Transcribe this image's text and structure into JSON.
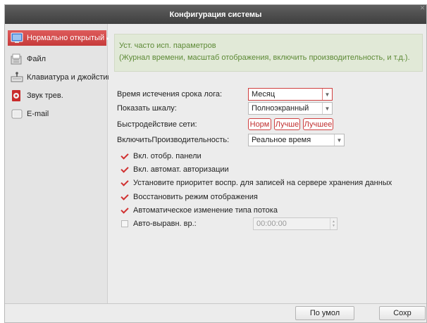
{
  "window": {
    "title": "Конфигурация системы",
    "close_glyph": "×"
  },
  "sidebar": {
    "items": [
      {
        "label": "Нормально открытый",
        "icon": "general-settings-icon",
        "active": true,
        "arrow": "▸"
      },
      {
        "label": "Файл",
        "icon": "file-icon",
        "active": false
      },
      {
        "label": "Клавиатура и джойстик",
        "icon": "keyboard-icon",
        "active": false
      },
      {
        "label": "Звук трев.",
        "icon": "alarm-sound-icon",
        "active": false
      },
      {
        "label": "E-mail",
        "icon": "email-icon",
        "active": false
      }
    ]
  },
  "info": {
    "line1": "Уст. часто исп. параметров",
    "line2": "(Журнал времени, масштаб отображения, включить производительность, и т.д.)."
  },
  "form": {
    "log_expiry": {
      "label": "Время истечения срока лога:",
      "value": "Месяц"
    },
    "display_scale": {
      "label": "Показать шкалу:",
      "value": "Полноэкранный"
    },
    "network_perf": {
      "label": "Быстродействие сети:",
      "options": [
        "Норм",
        "Лучше",
        "Лучшее"
      ]
    },
    "performance": {
      "label": "ВключитьПроизводительность:",
      "value": "Реальное время"
    },
    "checks": [
      {
        "label": "Вкл. отобр. панели",
        "checked": true
      },
      {
        "label": "Вкл. автомат. авторизации",
        "checked": true
      },
      {
        "label": "Установите приоритет воспр. для записей на сервере хранения данных",
        "checked": true
      },
      {
        "label": "Восстановить режим отображения",
        "checked": true
      },
      {
        "label": "Автоматическое изменение типа потока",
        "checked": true
      }
    ],
    "auto_time": {
      "label": "Авто-выравн. вр.:",
      "checked": false,
      "value": "00:00:00"
    }
  },
  "buttons": {
    "default": "По умол",
    "save": "Сохр"
  },
  "colors": {
    "accent": "#d04040",
    "info_text": "#5d8a36",
    "info_bg": "#e1e9d7",
    "titlebar": "#4a4a4a"
  }
}
